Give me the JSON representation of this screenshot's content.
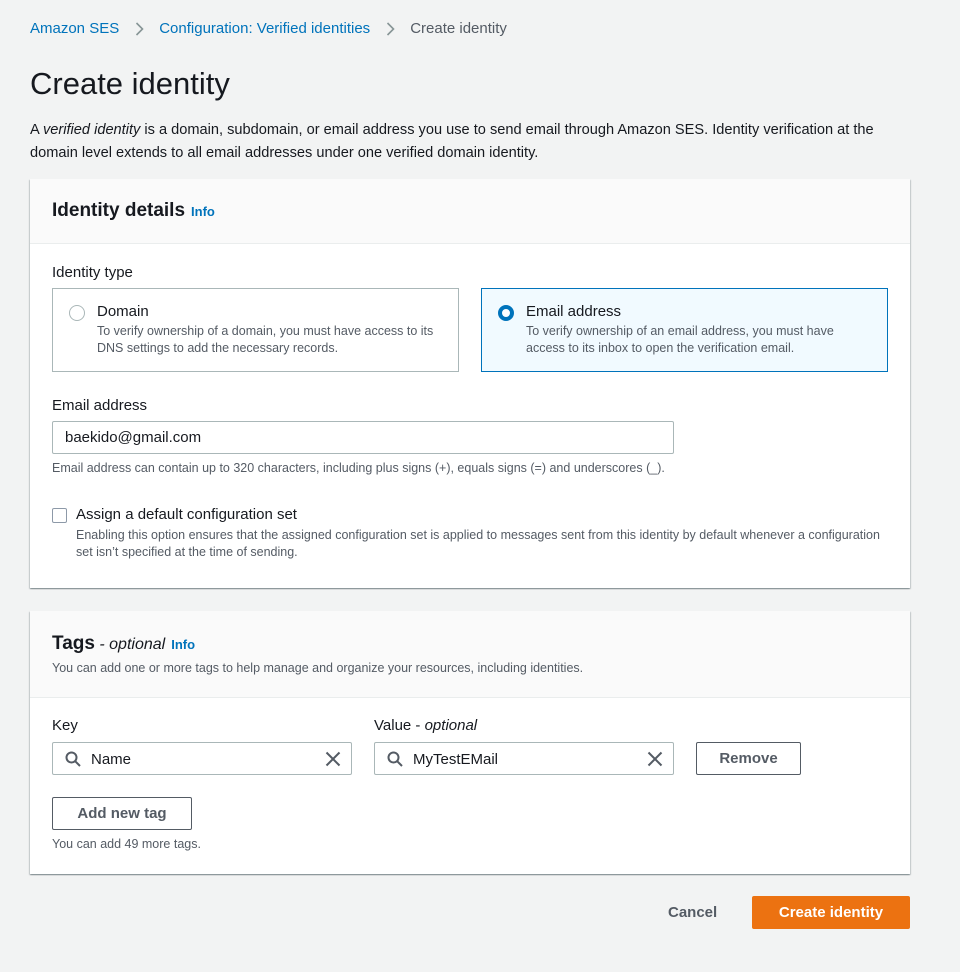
{
  "breadcrumb": {
    "items": [
      {
        "label": "Amazon SES"
      },
      {
        "label": "Configuration: Verified identities"
      },
      {
        "label": "Create identity"
      }
    ]
  },
  "page": {
    "title": "Create identity",
    "description_prefix": "A ",
    "description_em": "verified identity",
    "description_rest": " is a domain, subdomain, or email address you use to send email through Amazon SES. Identity verification at the domain level extends to all email addresses under one verified domain identity."
  },
  "identity_panel": {
    "title": "Identity details",
    "info": "Info",
    "identity_type_label": "Identity type",
    "options": [
      {
        "title": "Domain",
        "description": "To verify ownership of a domain, you must have access to its DNS settings to add the necessary records.",
        "selected": false
      },
      {
        "title": "Email address",
        "description": "To verify ownership of an email address, you must have access to its inbox to open the verification email.",
        "selected": true
      }
    ],
    "email_label": "Email address",
    "email_value": "baekido@gmail.com",
    "email_hint": "Email address can contain up to 320 characters, including plus signs (+), equals signs (=) and underscores (_).",
    "config_set": {
      "title": "Assign a default configuration set",
      "description": "Enabling this option ensures that the assigned configuration set is applied to messages sent from this identity by default whenever a configuration set isn’t specified at the time of sending.",
      "checked": false
    }
  },
  "tags_panel": {
    "title": "Tags",
    "optional": " - optional",
    "info": "Info",
    "description": "You can add one or more tags to help manage and organize your resources, including identities.",
    "key_label": "Key",
    "value_label": "Value - ",
    "value_optional": "optional",
    "key_value": "Name",
    "value_value": "MyTestEMail",
    "remove_label": "Remove",
    "add_label": "Add new tag",
    "remaining": "You can add 49 more tags."
  },
  "footer": {
    "cancel_label": "Cancel",
    "create_label": "Create identity"
  },
  "colors": {
    "link": "#0073bb",
    "primary": "#ec7211",
    "selected_tile_bg": "#f1faff"
  }
}
